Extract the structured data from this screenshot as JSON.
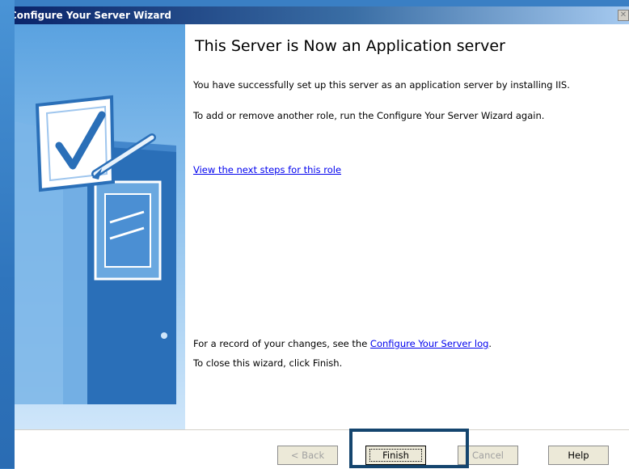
{
  "window": {
    "title": "Configure Your Server Wizard",
    "close_glyph": "✕"
  },
  "content": {
    "heading": "This Server is Now an Application server",
    "para1": "You have successfully set up this server as an application server by installing IIS.",
    "para2": "To add or remove another role, run the Configure Your Server Wizard again.",
    "next_steps_link": "View the next steps for this role",
    "record_prefix": "For a record of your changes, see the ",
    "record_link": "Configure Your Server log",
    "record_suffix": ".",
    "close_text": "To close this wizard, click Finish."
  },
  "buttons": {
    "back": "< Back",
    "finish": "Finish",
    "cancel": "Cancel",
    "help": "Help"
  },
  "colors": {
    "titlebar_start": "#0a246a",
    "link": "#0000ee",
    "highlight_box": "#14456e"
  },
  "icons": {
    "sidebar_illustration": "server-with-checkmark-document-icon"
  }
}
